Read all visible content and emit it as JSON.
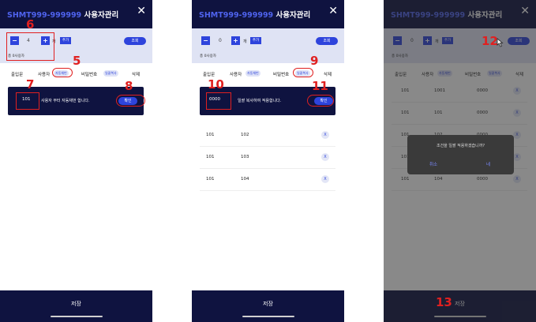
{
  "app": {
    "title_code": "SHMT999-999999",
    "title_text": "사용자관리",
    "close": "✕"
  },
  "controls": {
    "minus": "−",
    "plus": "+",
    "unit": "개",
    "add_label": "추가",
    "view_label": "조회",
    "total_label": "총 0사용자"
  },
  "columns": {
    "floor_unit": "출입문",
    "user": "사용자",
    "user_pill": "자동채번",
    "password": "비밀번호",
    "password_pill": "일괄복사",
    "delete": "삭제"
  },
  "screen1": {
    "quantity": "4",
    "bulk_value": "101",
    "bulk_message": "사용자 부터 자동채번 합니다.",
    "confirm": "확인"
  },
  "screen2": {
    "quantity": "0",
    "bulk_value": "0000",
    "bulk_message": "일괄 복사하여 적용합니다.",
    "confirm": "확인",
    "rows": [
      {
        "door": "101",
        "user": "102",
        "del": "X"
      },
      {
        "door": "101",
        "user": "103",
        "del": "X"
      },
      {
        "door": "101",
        "user": "104",
        "del": "X"
      }
    ]
  },
  "screen3": {
    "quantity": "0",
    "rows": [
      {
        "door": "101",
        "user": "1001",
        "pw": "0000",
        "del": "X"
      },
      {
        "door": "101",
        "user": "101",
        "pw": "0000",
        "del": "X"
      },
      {
        "door": "101",
        "user": "102",
        "pw": "0000",
        "del": "X"
      },
      {
        "door": "101",
        "user": "103",
        "pw": "0000",
        "del": "X"
      },
      {
        "door": "101",
        "user": "104",
        "pw": "0000",
        "del": "X"
      }
    ],
    "dialog": {
      "message": "조건을 일괄 적용하겠습니까?",
      "cancel": "취소",
      "ok": "네"
    }
  },
  "footer": {
    "save": "저장"
  },
  "annotations": [
    "6",
    "5",
    "7",
    "8",
    "10",
    "9",
    "11",
    "12",
    "13"
  ]
}
